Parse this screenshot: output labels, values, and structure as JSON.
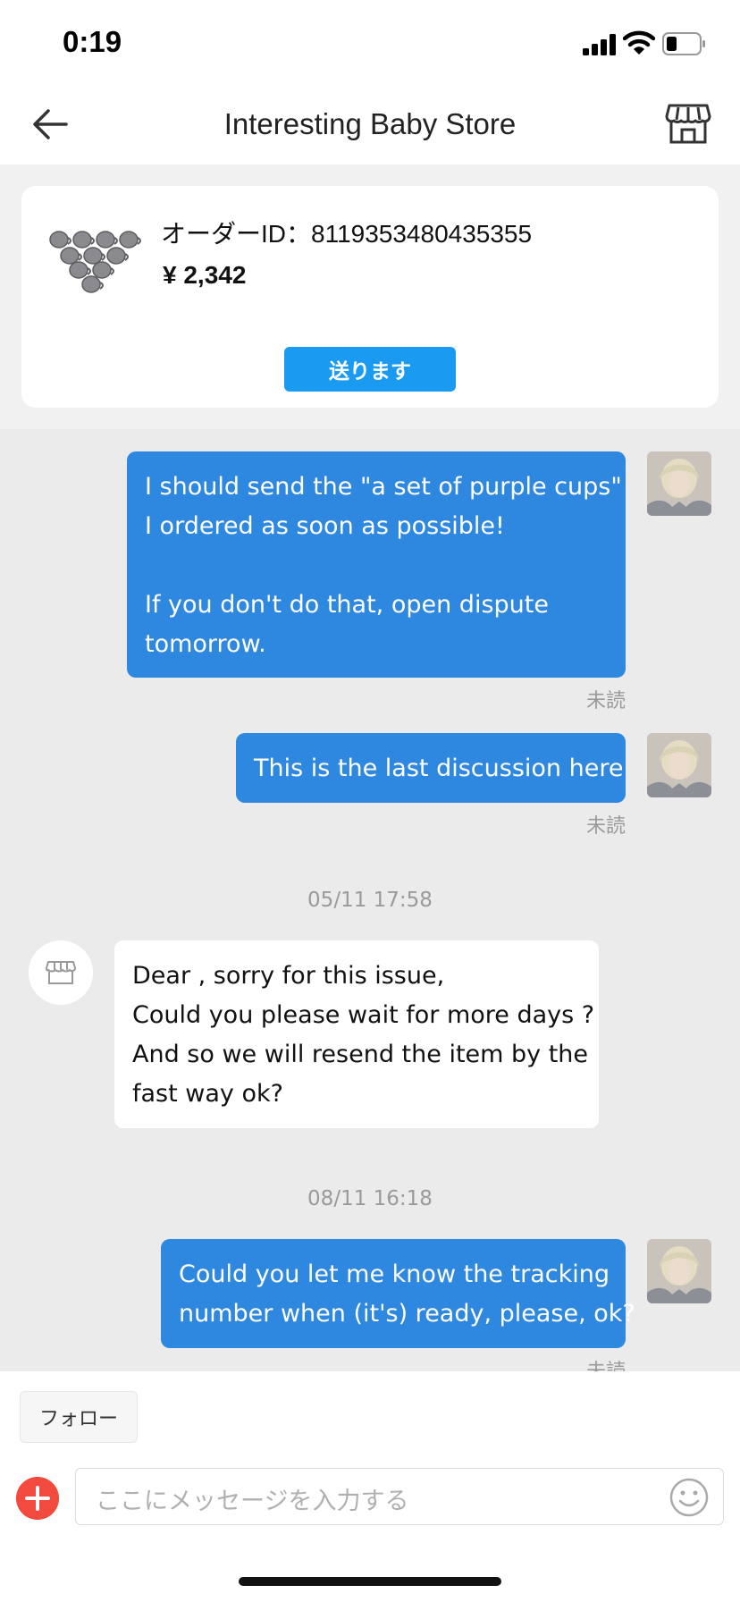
{
  "status_bar": {
    "time": "0:19"
  },
  "header": {
    "title": "Interesting Baby Store"
  },
  "order": {
    "order_id_label": "オーダーID：8119353480435355",
    "price": "¥ 2,342",
    "send_button": "送ります"
  },
  "messages": {
    "m1": {
      "line1": "I should send the \"a set of purple cups\"",
      "line2": "I ordered as soon as possible!",
      "line3": "If you don't do that, open dispute",
      "line4": "tomorrow.",
      "status": "未読"
    },
    "m2": {
      "text": "This is the last discussion here",
      "status": "未読"
    },
    "ts1": "05/11 17:58",
    "m3": {
      "line1": "Dear , sorry for  this issue,",
      "line2": "Could you please wait for more days ?",
      "line3": "And so we will resend the item by the",
      "line4": "fast way ok?"
    },
    "ts2": "08/11 16:18",
    "m4": {
      "line1": "Could you let me know the tracking",
      "line2": "number when (it's) ready, please, ok?",
      "status": "未読"
    }
  },
  "footer": {
    "follow_button": "フォロー",
    "input_placeholder": "ここにメッセージを入力する"
  },
  "colors": {
    "outgoing_bubble": "#2e88e0",
    "send_button": "#1a9af0",
    "plus_button": "#f24a3e"
  },
  "icons": {
    "back": "arrow-left-icon",
    "store": "store-icon",
    "emoji": "smiley-icon",
    "plus": "plus-circle-icon"
  }
}
